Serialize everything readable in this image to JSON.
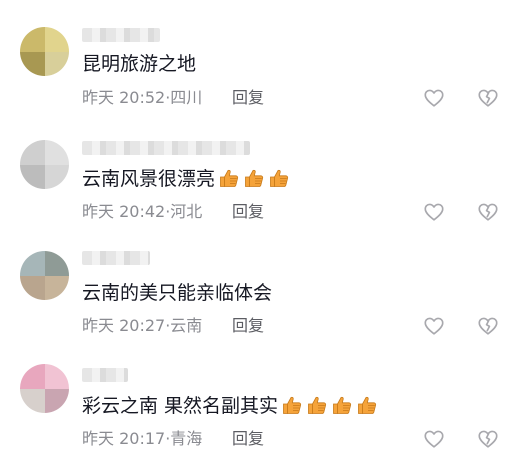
{
  "comments": [
    {
      "text": "昆明旅游之地",
      "time": "昨天 20:52",
      "location": "四川",
      "reply_label": "回复",
      "thumbs": 0,
      "avatar_colors": [
        "#cbb96a",
        "#e1d48d",
        "#a89852",
        "#d8cf9a"
      ]
    },
    {
      "text": "云南风景很漂亮",
      "time": "昨天 20:42",
      "location": "河北",
      "reply_label": "回复",
      "thumbs": 3,
      "avatar_colors": [
        "#cfcfcf",
        "#e0e0e0",
        "#bcbcbc",
        "#d6d6d6"
      ]
    },
    {
      "text": "云南的美只能亲临体会",
      "time": "昨天 20:27",
      "location": "云南",
      "reply_label": "回复",
      "thumbs": 0,
      "avatar_colors": [
        "#a6b6b8",
        "#8f9b96",
        "#b9a58e",
        "#c7b49a"
      ]
    },
    {
      "text": "彩云之南 果然名副其实",
      "time": "昨天 20:17",
      "location": "青海",
      "reply_label": "回复",
      "thumbs": 4,
      "avatar_colors": [
        "#e8a7be",
        "#f1c3d3",
        "#d7d0cc",
        "#c9a5b1"
      ]
    }
  ],
  "icons": {
    "like": "heart-outline-icon",
    "dislike": "broken-heart-outline-icon",
    "emoji": "thumbs-up-emoji-icon"
  },
  "colors": {
    "text": "#161823",
    "meta": "#8a8b91",
    "reply": "#5c5d63",
    "icon": "#a8a8ad",
    "thumb": "#f5a33a"
  }
}
